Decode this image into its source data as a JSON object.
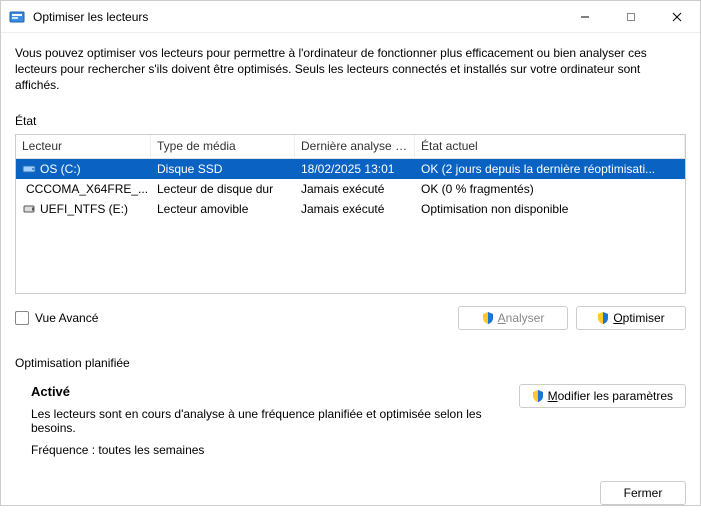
{
  "window": {
    "title": "Optimiser les lecteurs"
  },
  "intro": "Vous pouvez optimiser vos lecteurs pour permettre à l'ordinateur de fonctionner plus efficacement ou bien analyser ces lecteurs pour rechercher s'ils doivent être optimisés. Seuls les lecteurs connectés et installés sur votre ordinateur sont affichés.",
  "status_label": "État",
  "columns": {
    "c0": "Lecteur",
    "c1": "Type de média",
    "c2": "Dernière analyse o...",
    "c3": "État actuel"
  },
  "rows": [
    {
      "name": "OS (C:)",
      "media": "Disque SSD",
      "last": "18/02/2025 13:01",
      "state": "OK (2 jours depuis la dernière réoptimisati...",
      "icon": "ssd",
      "selected": true
    },
    {
      "name": "CCCOMA_X64FRE_...",
      "media": "Lecteur de disque dur",
      "last": "Jamais exécuté",
      "state": "OK (0 % fragmentés)",
      "icon": "hdd",
      "selected": false
    },
    {
      "name": "UEFI_NTFS (E:)",
      "media": "Lecteur amovible",
      "last": "Jamais exécuté",
      "state": "Optimisation non disponible",
      "icon": "usb",
      "selected": false
    }
  ],
  "advanced_view": "Vue Avancé",
  "buttons": {
    "analyze": "Analyser",
    "optimize": "Optimiser",
    "modify": "Modifier les paramètres",
    "close": "Fermer"
  },
  "schedule": {
    "header": "Optimisation planifiée",
    "title": "Activé",
    "desc": "Les lecteurs sont en cours d'analyse à une fréquence planifiée et optimisée selon les besoins.",
    "freq": "Fréquence : toutes les semaines"
  }
}
